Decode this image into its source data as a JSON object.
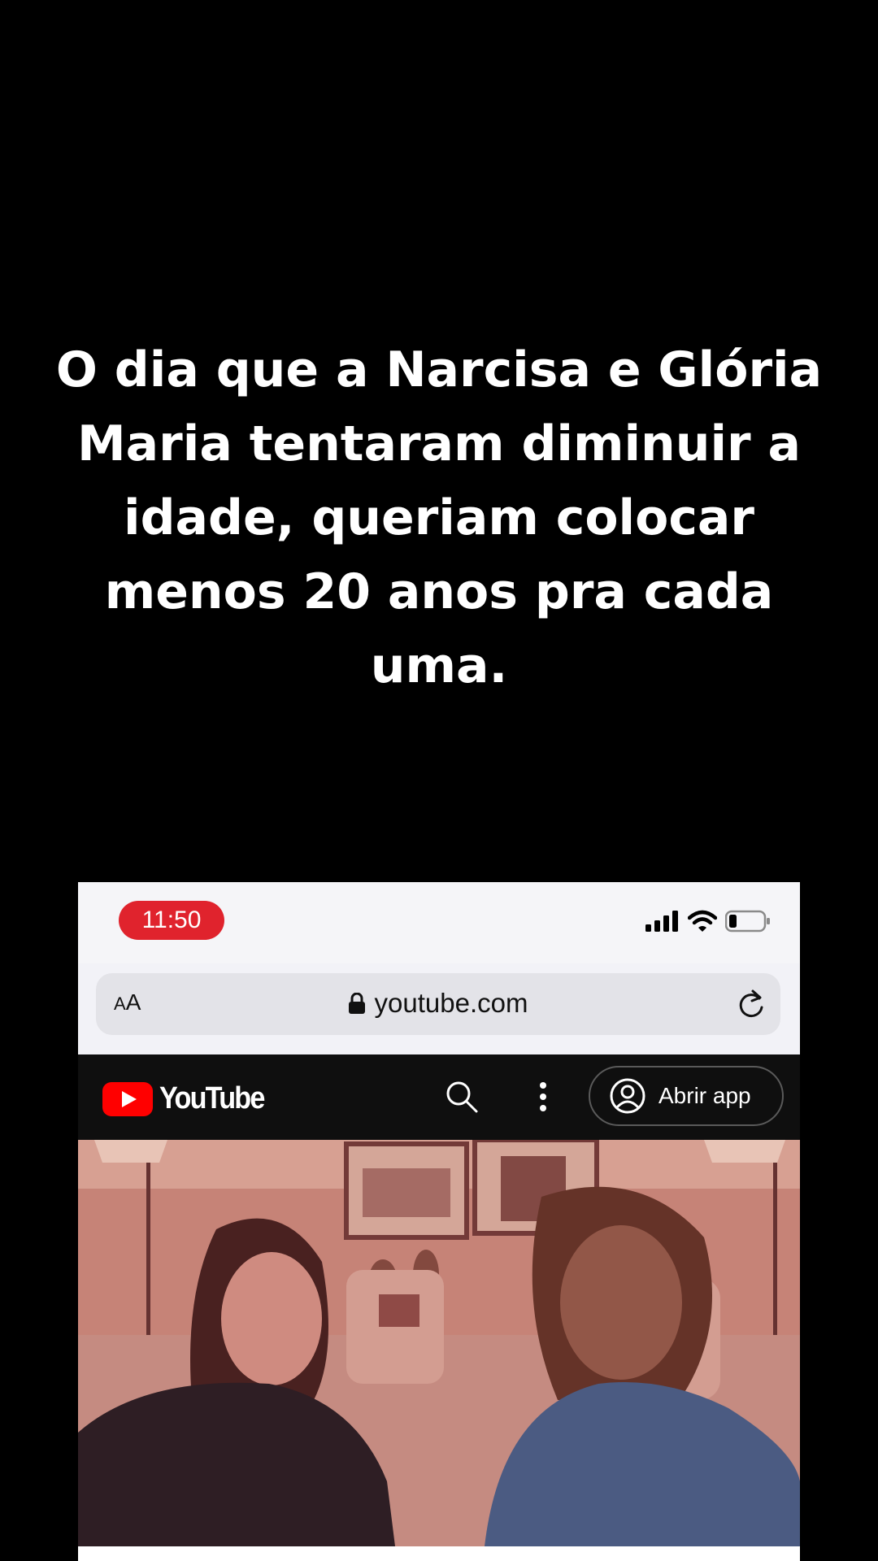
{
  "caption": {
    "line1": "O dia que a Narcisa e Glória",
    "line2": "Maria tentaram diminuir a",
    "line3": "idade, queriam colocar",
    "line4": "menos 20 anos pra cada",
    "line5": "uma."
  },
  "status_bar": {
    "time": "11:50",
    "icons": [
      "signal-icon",
      "wifi-icon",
      "battery-icon"
    ],
    "time_pill_color": "#e0232d"
  },
  "browser": {
    "text_size_label_small": "A",
    "text_size_label_large": "A",
    "url": "youtube.com",
    "icons": [
      "lock-icon",
      "reload-icon"
    ]
  },
  "youtube": {
    "logo_text": "YouTube",
    "open_app_label": "Abrir app",
    "icons": [
      "youtube-logo-icon",
      "search-icon",
      "more-vertical-icon",
      "account-icon"
    ],
    "brand_color": "#ff0000"
  },
  "video": {
    "description": "video-thumbnail"
  }
}
